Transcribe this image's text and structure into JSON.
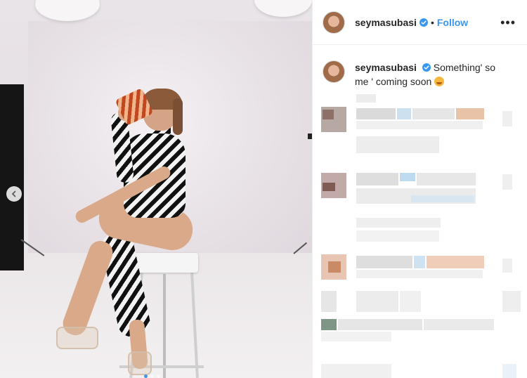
{
  "post": {
    "carousel": {
      "dot_count": 3,
      "active_index": 0
    }
  },
  "header": {
    "username": "seymasubasi",
    "separator": "•",
    "follow_label": "Follow",
    "more_label": "•••"
  },
  "caption": {
    "username": "seymasubasi",
    "text": "Something' so me ' coming soon"
  },
  "colors": {
    "accent": "#3897f0",
    "text": "#262626",
    "border": "#efefef"
  }
}
